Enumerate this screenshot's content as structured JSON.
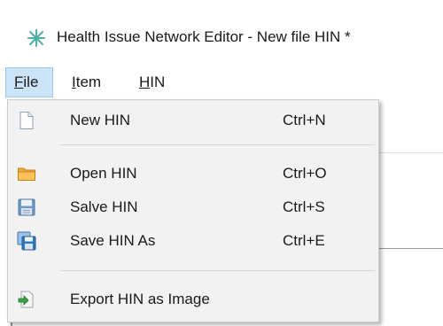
{
  "window": {
    "title": "Health Issue Network Editor - New file HIN *"
  },
  "menubar": {
    "items": [
      {
        "accel": "F",
        "rest": "ile",
        "active": true
      },
      {
        "accel": "I",
        "rest": "tem",
        "active": false
      },
      {
        "accel": "H",
        "rest": "IN",
        "active": false
      }
    ]
  },
  "file_menu": {
    "items": [
      {
        "label": "New HIN",
        "shortcut": "Ctrl+N",
        "icon": "new-file-icon"
      },
      {
        "label": "Open HIN",
        "shortcut": "Ctrl+O",
        "icon": "folder-icon"
      },
      {
        "label": "Salve HIN",
        "shortcut": "Ctrl+S",
        "icon": "save-icon"
      },
      {
        "label": "Save HIN As",
        "shortcut": "Ctrl+E",
        "icon": "save-as-icon"
      },
      {
        "label": "Export HIN as Image",
        "shortcut": "",
        "icon": "export-image-icon"
      }
    ]
  },
  "colors": {
    "menu_bg": "#f2f2f2",
    "menu_active": "#cce4f7",
    "accent_blue": "#1e7bd8"
  }
}
